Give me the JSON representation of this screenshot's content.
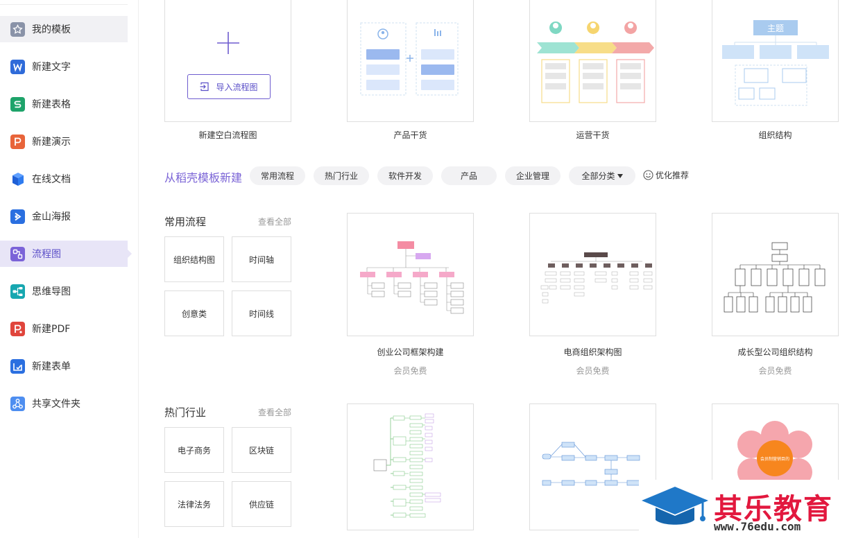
{
  "sidebar": {
    "items": [
      {
        "label": "我的模板",
        "icon": "star-icon",
        "color": "#8a93a8"
      },
      {
        "label": "新建文字",
        "icon": "word-icon",
        "color": "#2f6bd9"
      },
      {
        "label": "新建表格",
        "icon": "sheet-icon",
        "color": "#1ea36a"
      },
      {
        "label": "新建演示",
        "icon": "presentation-icon",
        "color": "#e8643a"
      },
      {
        "label": "在线文档",
        "icon": "online-doc-icon",
        "color": "#2a6fe0"
      },
      {
        "label": "金山海报",
        "icon": "poster-icon",
        "color": "#2a6fe0"
      },
      {
        "label": "流程图",
        "icon": "flowchart-icon",
        "color": "#7b63d8"
      },
      {
        "label": "思维导图",
        "icon": "mindmap-icon",
        "color": "#17a7b0"
      },
      {
        "label": "新建PDF",
        "icon": "pdf-icon",
        "color": "#e0453c"
      },
      {
        "label": "新建表单",
        "icon": "form-icon",
        "color": "#2a6fe0"
      },
      {
        "label": "共享文件夹",
        "icon": "shared-folder-icon",
        "color": "#4e8ef0"
      }
    ]
  },
  "top_cards": [
    {
      "label": "新建空白流程图",
      "button": "导入流程图"
    },
    {
      "label": "产品干货"
    },
    {
      "label": "运营干货"
    },
    {
      "label": "组织结构",
      "preview_title": "主题"
    }
  ],
  "template_section": {
    "title": "从稻壳模板新建",
    "filters": [
      "常用流程",
      "热门行业",
      "软件开发",
      "产品",
      "企业管理",
      "全部分类"
    ],
    "recommend": "优化推荐"
  },
  "categories": [
    {
      "title": "常用流程",
      "see_all": "查看全部",
      "items": [
        "组织结构图",
        "时间轴",
        "创意类",
        "时间线"
      ],
      "templates": [
        {
          "label": "创业公司框架构建",
          "tag": "会员免费"
        },
        {
          "label": "电商组织架构图",
          "tag": "会员免费"
        },
        {
          "label": "成长型公司组织结构",
          "tag": "会员免费"
        }
      ]
    },
    {
      "title": "热门行业",
      "see_all": "查看全部",
      "items": [
        "电子商务",
        "区块链",
        "法律法务",
        "供应链"
      ],
      "templates": [
        {
          "label": ""
        },
        {
          "label": ""
        },
        {
          "label": "",
          "center_text": "会员制营销目的"
        }
      ]
    }
  ],
  "watermark": {
    "text": "其乐教育",
    "url": "www.76edu.com"
  },
  "colors": {
    "accent": "#6e5ccf",
    "border": "#dedede",
    "muted": "#999999"
  }
}
